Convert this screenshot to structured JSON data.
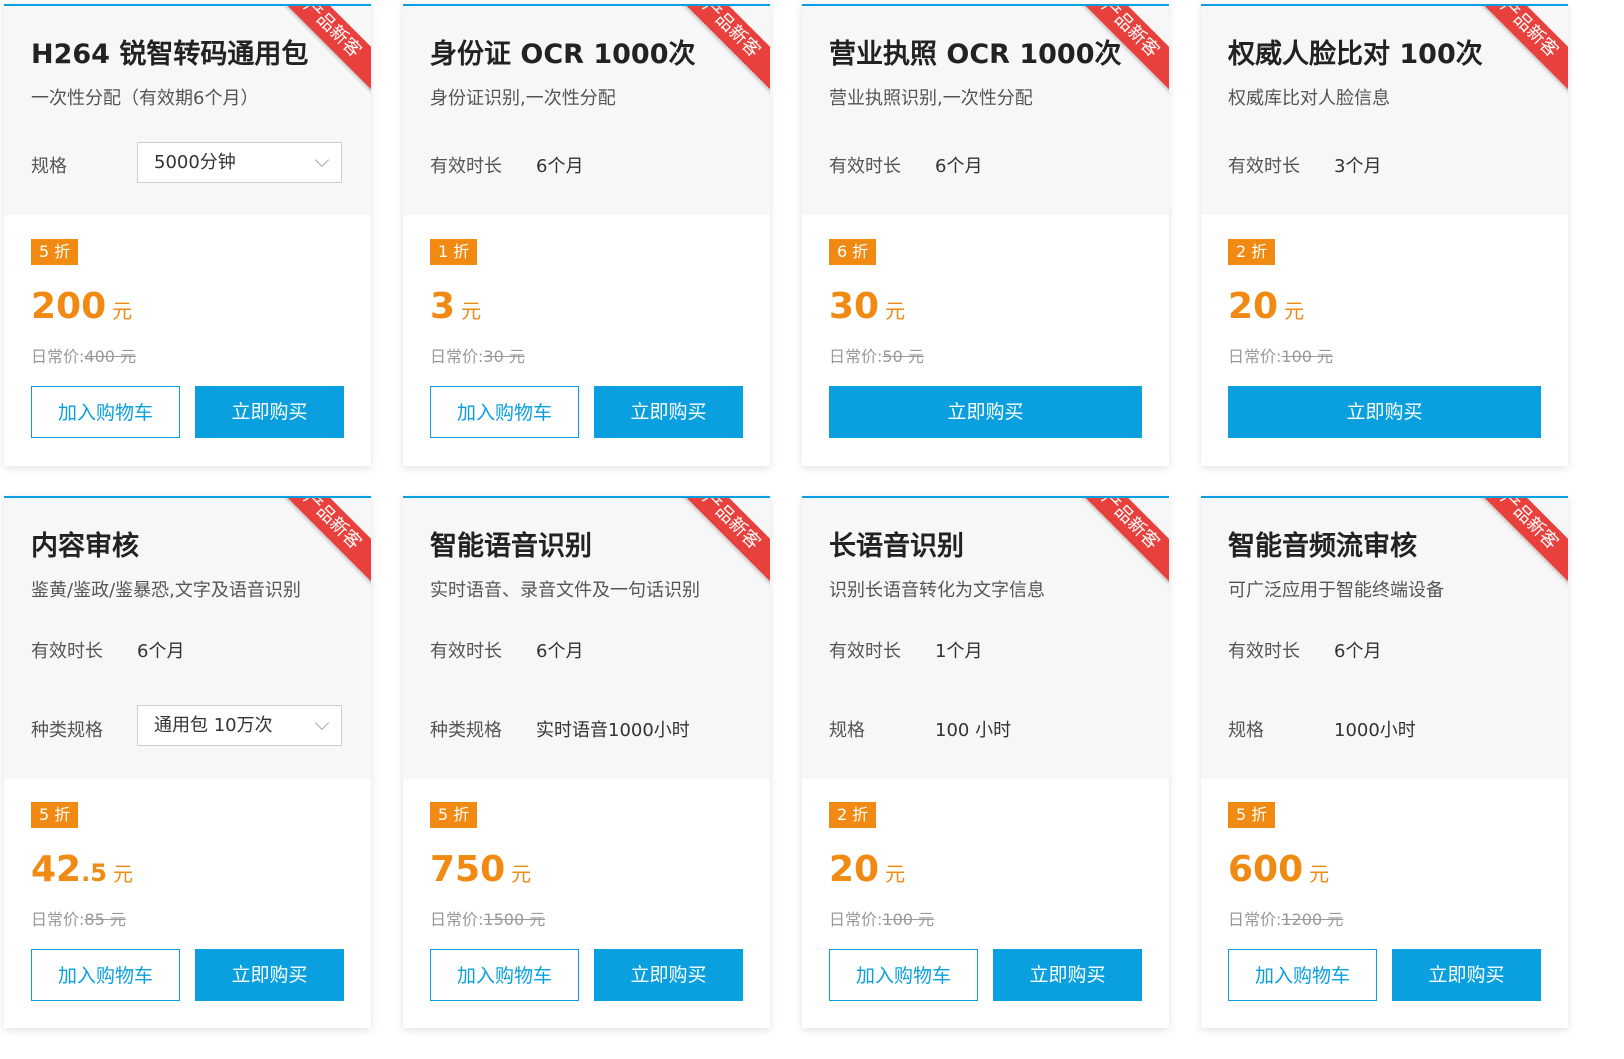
{
  "ribbon_text": "产品新客",
  "labels": {
    "spec": "规格",
    "validity": "有效时长",
    "type_spec": "种类规格",
    "orig_prefix": "日常价:",
    "currency": "元",
    "cart": "加入购物车",
    "buy": "立即购买"
  },
  "colors": {
    "accent": "#0aa0e0",
    "price": "#f08a13",
    "ribbon": "#e8413d"
  },
  "cards": [
    {
      "title": "H264 锐智转码通用包",
      "desc": "一次性分配（有效期6个月）",
      "spec_select": "5000分钟",
      "discount": "5 折",
      "price": "200",
      "orig": "400 元"
    },
    {
      "title": "身份证 OCR 1000次",
      "desc": "身份证识别,一次性分配",
      "validity": "6个月",
      "discount": "1 折",
      "price": "3",
      "orig": "30 元"
    },
    {
      "title": "营业执照 OCR 1000次",
      "desc": "营业执照识别,一次性分配",
      "validity": "6个月",
      "discount": "6 折",
      "price": "30",
      "orig": "50 元"
    },
    {
      "title": "权威人脸比对 100次",
      "desc": "权威库比对人脸信息",
      "validity": "3个月",
      "discount": "2 折",
      "price": "20",
      "orig": "100 元"
    },
    {
      "title": "内容审核",
      "desc": "鉴黄/鉴政/鉴暴恐,文字及语音识别",
      "validity": "6个月",
      "type_select": "通用包 10万次",
      "discount": "5 折",
      "price_int": "42",
      "price_dec": ".5",
      "orig": "85 元"
    },
    {
      "title": "智能语音识别",
      "desc": "实时语音、录音文件及一句话识别",
      "validity": "6个月",
      "type_value": "实时语音1000小时",
      "discount": "5 折",
      "price": "750",
      "orig": "1500 元"
    },
    {
      "title": "长语音识别",
      "desc": "识别长语音转化为文字信息",
      "validity": "1个月",
      "spec_value": "100 小时",
      "discount": "2 折",
      "price": "20",
      "orig": "100 元"
    },
    {
      "title": "智能音频流审核",
      "desc": "可广泛应用于智能终端设备",
      "validity": "6个月",
      "spec_value": "1000小时",
      "discount": "5 折",
      "price": "600",
      "orig": "1200 元"
    }
  ]
}
